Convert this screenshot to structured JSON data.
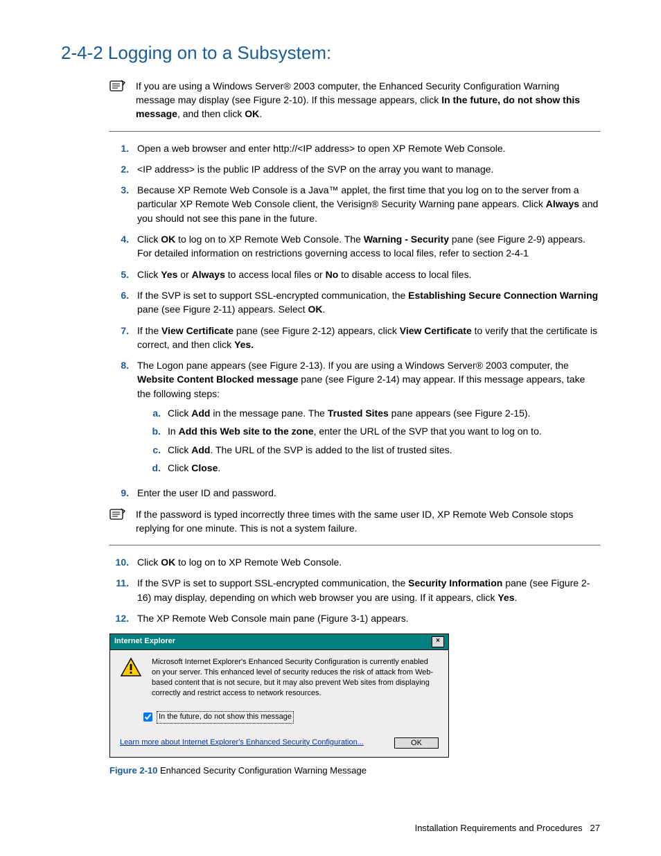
{
  "heading": "2-4-2 Logging on to a Subsystem:",
  "note1_html": "If you are using a Windows Server® 2003 computer, the Enhanced Security Configuration Warning message may display (see Figure 2-10). If this message appears, click <b>In the future, do not show this message</b>, and then click <b>OK</b>.",
  "steps": [
    {
      "n": "1.",
      "html": "Open a web browser and enter http://&lt;IP address&gt; to open XP Remote Web Console."
    },
    {
      "n": "2.",
      "html": "&lt;IP address&gt; is the public IP address of the SVP on the array you want to manage."
    },
    {
      "n": "3.",
      "html": "Because XP Remote Web Console is a Java™ applet, the first time that you log on to the server from a particular XP Remote Web Console client, the Verisign® Security Warning pane appears. Click <b>Always</b> and you should not see this pane in the future."
    },
    {
      "n": "4.",
      "html": "Click <b>OK</b> to log on to XP Remote Web Console. The <b>Warning - Security</b> pane (see Figure 2-9) appears. For detailed information on restrictions governing access to local files, refer to section 2-4-1"
    },
    {
      "n": "5.",
      "html": "Click <b>Yes</b> or <b>Always</b> to access local files or <b>No</b> to disable access to local files."
    },
    {
      "n": "6.",
      "html": "If the SVP is set to support SSL-encrypted communication, the <b>Establishing Secure Connection Warning</b> pane (see Figure 2-11) appears. Select <b>OK</b>."
    },
    {
      "n": "7.",
      "html": "If the <b>View Certificate</b> pane (see Figure 2-12) appears, click <b>View Certificate</b> to verify that the certificate is correct, and then click <b>Yes.</b>"
    },
    {
      "n": "8.",
      "html": "The Logon pane appears (see Figure 2-13). If you are using a Windows Server® 2003 computer, the <b>Website Content Blocked message</b> pane (see Figure 2-14) may appear. If this message appears, take the following steps:",
      "sub": [
        {
          "n": "a.",
          "html": "Click <b>Add</b> in the message pane. The <b>Trusted Sites</b> pane appears (see Figure 2-15)."
        },
        {
          "n": "b.",
          "html": "In <b>Add this Web site to the zone</b>, enter the URL of the SVP that you want to log on to."
        },
        {
          "n": "c.",
          "html": "Click <b>Add</b>. The URL of the SVP is added to the list of trusted sites."
        },
        {
          "n": "d.",
          "html": "Click <b>Close</b>."
        }
      ]
    },
    {
      "n": "9.",
      "html": "Enter the user ID and password."
    }
  ],
  "note2_html": "If the password is typed incorrectly three times with the same user ID, XP Remote Web Console stops replying for one minute. This is not a system failure.",
  "steps2": [
    {
      "n": "10.",
      "html": "Click <b>OK</b> to log on to XP Remote Web Console."
    },
    {
      "n": "11.",
      "html": "If the SVP is set to support SSL-encrypted communication, the <b>Security Information</b> pane (see Figure 2-16) may display, depending on which web browser you are using. If it appears, click <b>Yes</b>."
    },
    {
      "n": "12.",
      "html": "The XP Remote Web Console main pane (Figure 3-1) appears."
    }
  ],
  "dialog": {
    "title": "Internet Explorer",
    "close": "×",
    "message": "Microsoft Internet Explorer's Enhanced Security Configuration is currently enabled on your server.  This enhanced level of security reduces the risk of attack from Web-based content that is not secure, but it may also prevent Web sites from displaying correctly and restrict access to network resources.",
    "checkbox_label": "In the future, do not show this message",
    "link": "Learn more about Internet Explorer's Enhanced Security Configuration...",
    "ok": "OK"
  },
  "figure": {
    "num": "Figure 2-10",
    "caption": " Enhanced Security Configuration Warning Message"
  },
  "footer": {
    "text": "Installation Requirements and Procedures",
    "page": "27"
  }
}
